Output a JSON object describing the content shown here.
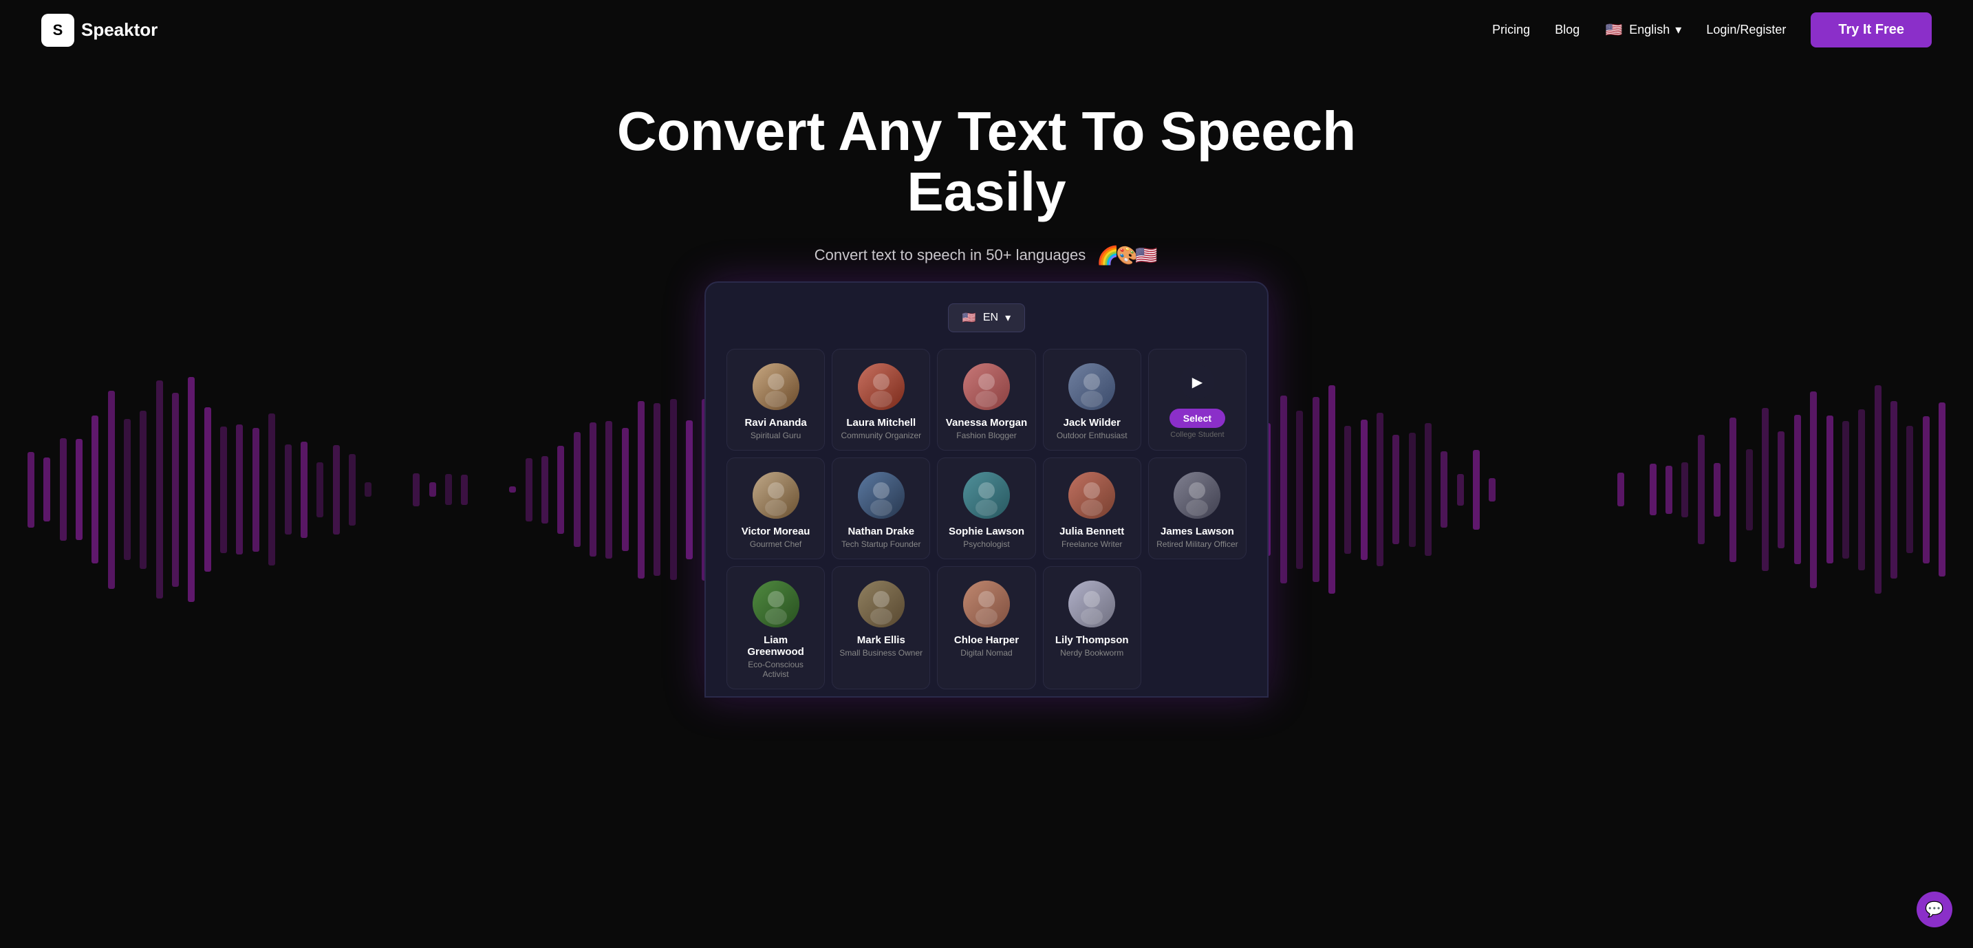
{
  "brand": {
    "logo_letter": "S",
    "name": "peaktor"
  },
  "nav": {
    "pricing": "Pricing",
    "blog": "Blog",
    "language": "English",
    "login": "Login/Register",
    "try_btn": "Try It Free",
    "chevron": "▾",
    "flag_emoji": "🇺🇸"
  },
  "hero": {
    "title": "Convert Any Text To Speech Easily",
    "subtitle": "Convert text to speech in 50+ languages",
    "flags": [
      "🌈",
      "🎨",
      "🇺🇸"
    ]
  },
  "device": {
    "lang_btn": "EN",
    "flag_emoji": "🇺🇸"
  },
  "voices": [
    {
      "id": "ravi",
      "name": "Ravi Ananda",
      "role": "Spiritual Guru",
      "av_class": "av-ravi",
      "emoji": "🧔"
    },
    {
      "id": "laura",
      "name": "Laura Mitchell",
      "role": "Community Organizer",
      "av_class": "av-laura",
      "emoji": "👩"
    },
    {
      "id": "vanessa",
      "name": "Vanessa Morgan",
      "role": "Fashion Blogger",
      "av_class": "av-vanessa",
      "emoji": "👩‍🦱"
    },
    {
      "id": "jack",
      "name": "Jack Wilder",
      "role": "Outdoor Enthusiast",
      "av_class": "av-jack",
      "emoji": "👨"
    },
    {
      "id": "select",
      "name": "College Student",
      "role": "",
      "av_class": "",
      "emoji": "",
      "is_select": true
    },
    {
      "id": "victor",
      "name": "Victor Moreau",
      "role": "Gourmet Chef",
      "av_class": "av-victor",
      "emoji": "👨‍🍳"
    },
    {
      "id": "nathan",
      "name": "Nathan Drake",
      "role": "Tech Startup Founder",
      "av_class": "av-nathan",
      "emoji": "👨‍💼"
    },
    {
      "id": "sophie",
      "name": "Sophie Lawson",
      "role": "Psychologist",
      "av_class": "av-sophie",
      "emoji": "👩‍🔬"
    },
    {
      "id": "julia",
      "name": "Julia Bennett",
      "role": "Freelance Writer",
      "av_class": "av-julia",
      "emoji": "👩‍💻"
    },
    {
      "id": "james",
      "name": "James Lawson",
      "role": "Retired Military Officer",
      "av_class": "av-james",
      "emoji": "👴"
    },
    {
      "id": "liam",
      "name": "Liam Greenwood",
      "role": "Eco-Conscious Activist",
      "av_class": "av-liam",
      "emoji": "🧑"
    },
    {
      "id": "mark",
      "name": "Mark Ellis",
      "role": "Small Business Owner",
      "av_class": "av-mark",
      "emoji": "👨‍🦳"
    },
    {
      "id": "chloe",
      "name": "Chloe Harper",
      "role": "Digital Nomad",
      "av_class": "av-chloe",
      "emoji": "👩‍🦰"
    },
    {
      "id": "lily",
      "name": "Lily Thompson",
      "role": "Nerdy Bookworm",
      "av_class": "av-lily",
      "emoji": "👓"
    }
  ],
  "select_label": "Select",
  "chat_icon": "💬",
  "colors": {
    "accent": "#8b2fc9",
    "bg": "#0a0a0a",
    "card_bg": "#1e1e30",
    "wave": "#6b1a7a"
  }
}
